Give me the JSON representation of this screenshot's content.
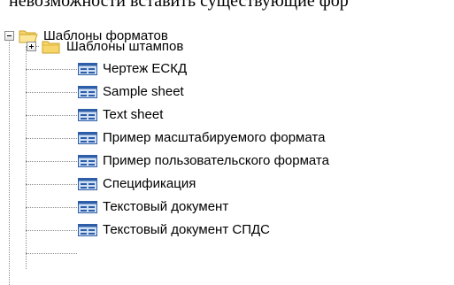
{
  "top_text": "невозможности вставить существующие фор",
  "tree": {
    "root": {
      "label": "Шаблоны форматов",
      "icon": "folder-open-icon",
      "expanded": true
    },
    "items": [
      {
        "label": "Шаблоны штампов",
        "icon": "folder-icon",
        "expanded": false
      },
      {
        "label": "Чертеж ЕСКД",
        "icon": "sheet-template-icon"
      },
      {
        "label": "Sample sheet",
        "icon": "sheet-template-icon"
      },
      {
        "label": "Text sheet",
        "icon": "sheet-template-icon"
      },
      {
        "label": "Пример масштабируемого формата",
        "icon": "sheet-template-icon"
      },
      {
        "label": "Пример пользовательского формата",
        "icon": "sheet-template-icon"
      },
      {
        "label": "Спецификация",
        "icon": "sheet-template-icon"
      },
      {
        "label": "Текстовый документ",
        "icon": "sheet-template-icon"
      },
      {
        "label": "Текстовый документ СПДС",
        "icon": "sheet-template-icon"
      }
    ]
  },
  "colors": {
    "folder_fill": "#f6d56a",
    "folder_edge": "#c9a227",
    "sheet_blue": "#2f5ea8",
    "sheet_light": "#cfe0f5"
  }
}
